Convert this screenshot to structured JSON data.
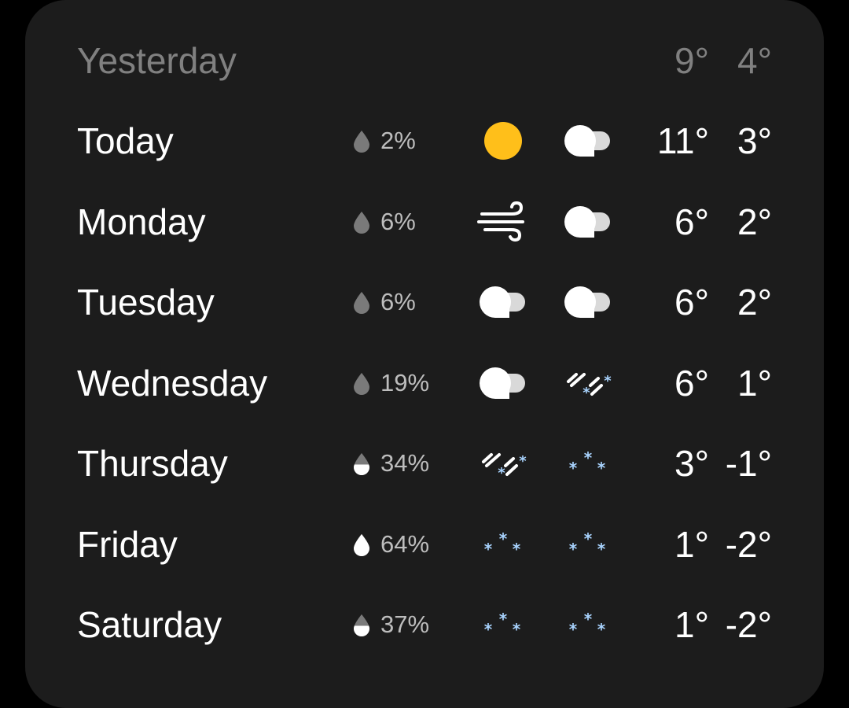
{
  "yesterday": {
    "label": "Yesterday",
    "high": "9°",
    "low": "4°"
  },
  "days": [
    {
      "label": "Today",
      "precip": "2%",
      "precip_fill": 0.02,
      "day_icon": "sun-icon",
      "night_icon": "cloud-icon",
      "high": "11°",
      "low": "3°"
    },
    {
      "label": "Monday",
      "precip": "6%",
      "precip_fill": 0.06,
      "day_icon": "wind-icon",
      "night_icon": "cloud-icon",
      "high": "6°",
      "low": "2°"
    },
    {
      "label": "Tuesday",
      "precip": "6%",
      "precip_fill": 0.06,
      "day_icon": "cloud-icon",
      "night_icon": "cloud-icon",
      "high": "6°",
      "low": "2°"
    },
    {
      "label": "Wednesday",
      "precip": "19%",
      "precip_fill": 0.19,
      "day_icon": "cloud-icon",
      "night_icon": "sleet-icon",
      "high": "6°",
      "low": "1°"
    },
    {
      "label": "Thursday",
      "precip": "34%",
      "precip_fill": 0.34,
      "day_icon": "sleet-icon",
      "night_icon": "snow-icon",
      "high": "3°",
      "low": "-1°"
    },
    {
      "label": "Friday",
      "precip": "64%",
      "precip_fill": 0.64,
      "day_icon": "snow-icon",
      "night_icon": "snow-icon",
      "high": "1°",
      "low": "-2°"
    },
    {
      "label": "Saturday",
      "precip": "37%",
      "precip_fill": 0.37,
      "day_icon": "snow-icon",
      "night_icon": "snow-icon",
      "high": "1°",
      "low": "-2°"
    }
  ],
  "colors": {
    "card_background": "#1c1c1c",
    "text_primary": "#ffffff",
    "text_muted": "#808080",
    "precip_text": "#bdbdbd",
    "sun": "#ffbf1a",
    "snow": "#a9d4ff",
    "drop_filled": "#ffffff",
    "drop_empty": "#7a7a7a"
  }
}
